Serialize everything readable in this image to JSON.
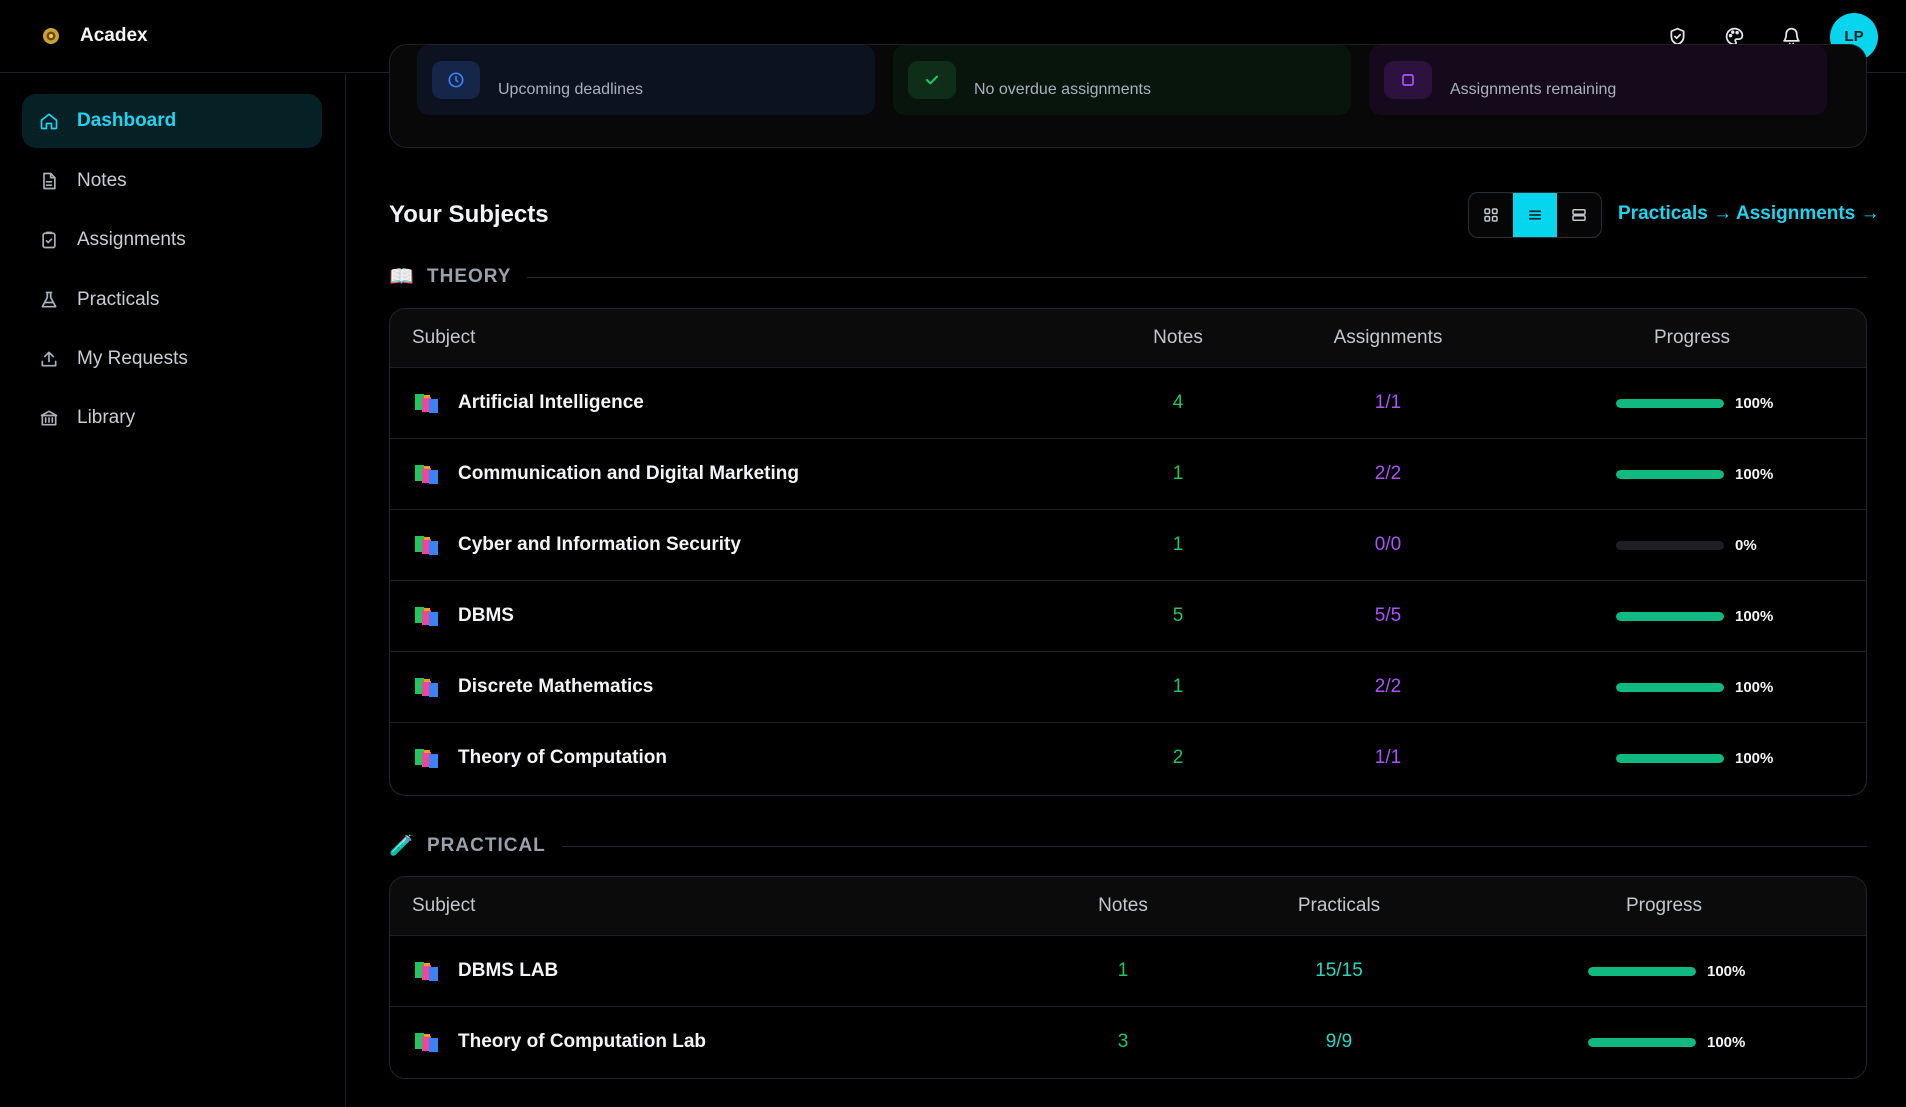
{
  "app": {
    "name": "Acadex",
    "avatar_initials": "LP"
  },
  "topbar_icons": [
    "shield-check-icon",
    "palette-icon",
    "bell-icon"
  ],
  "sidebar": {
    "items": [
      {
        "label": "Dashboard",
        "icon": "home-icon",
        "active": true
      },
      {
        "label": "Notes",
        "icon": "document-icon",
        "active": false
      },
      {
        "label": "Assignments",
        "icon": "clipboard-check-icon",
        "active": false
      },
      {
        "label": "Practicals",
        "icon": "flask-icon",
        "active": false
      },
      {
        "label": "My Requests",
        "icon": "upload-icon",
        "active": false
      },
      {
        "label": "Library",
        "icon": "library-icon",
        "active": false
      }
    ]
  },
  "stats": [
    {
      "subtitle": "Upcoming deadlines",
      "icon": "clock-icon",
      "color": "#3b82f6"
    },
    {
      "subtitle": "No overdue assignments",
      "icon": "check-icon",
      "color": "#22c55e"
    },
    {
      "subtitle": "Assignments remaining",
      "icon": "square-icon",
      "color": "#a855f7"
    }
  ],
  "subjects": {
    "title": "Your Subjects",
    "view_modes": [
      "grid-view-icon",
      "list-view-icon",
      "compact-view-icon"
    ],
    "active_view": "list-view-icon",
    "links": {
      "practicals": "Practicals →",
      "assignments": "Assignments →"
    }
  },
  "theory": {
    "label": "THEORY",
    "emoji": "📖",
    "headers": {
      "subject": "Subject",
      "notes": "Notes",
      "assignments": "Assignments",
      "progress": "Progress"
    },
    "rows": [
      {
        "name": "Artificial Intelligence",
        "notes": "4",
        "count": "1/1",
        "progress": 1.0,
        "pct": "100%"
      },
      {
        "name": "Communication and Digital Marketing",
        "notes": "1",
        "count": "2/2",
        "progress": 1.0,
        "pct": "100%"
      },
      {
        "name": "Cyber and Information Security",
        "notes": "1",
        "count": "0/0",
        "progress": 0.0,
        "pct": "0%"
      },
      {
        "name": "DBMS",
        "notes": "5",
        "count": "5/5",
        "progress": 1.0,
        "pct": "100%"
      },
      {
        "name": "Discrete Mathematics",
        "notes": "1",
        "count": "2/2",
        "progress": 1.0,
        "pct": "100%"
      },
      {
        "name": "Theory of Computation",
        "notes": "2",
        "count": "1/1",
        "progress": 1.0,
        "pct": "100%"
      }
    ]
  },
  "practical": {
    "label": "PRACTICAL",
    "emoji": "🧪",
    "headers": {
      "subject": "Subject",
      "notes": "Notes",
      "practicals": "Practicals",
      "progress": "Progress"
    },
    "rows": [
      {
        "name": "DBMS LAB",
        "notes": "1",
        "count": "15/15",
        "progress": 1.0,
        "pct": "100%"
      },
      {
        "name": "Theory of Computation Lab",
        "notes": "3",
        "count": "9/9",
        "progress": 1.0,
        "pct": "100%"
      }
    ]
  }
}
